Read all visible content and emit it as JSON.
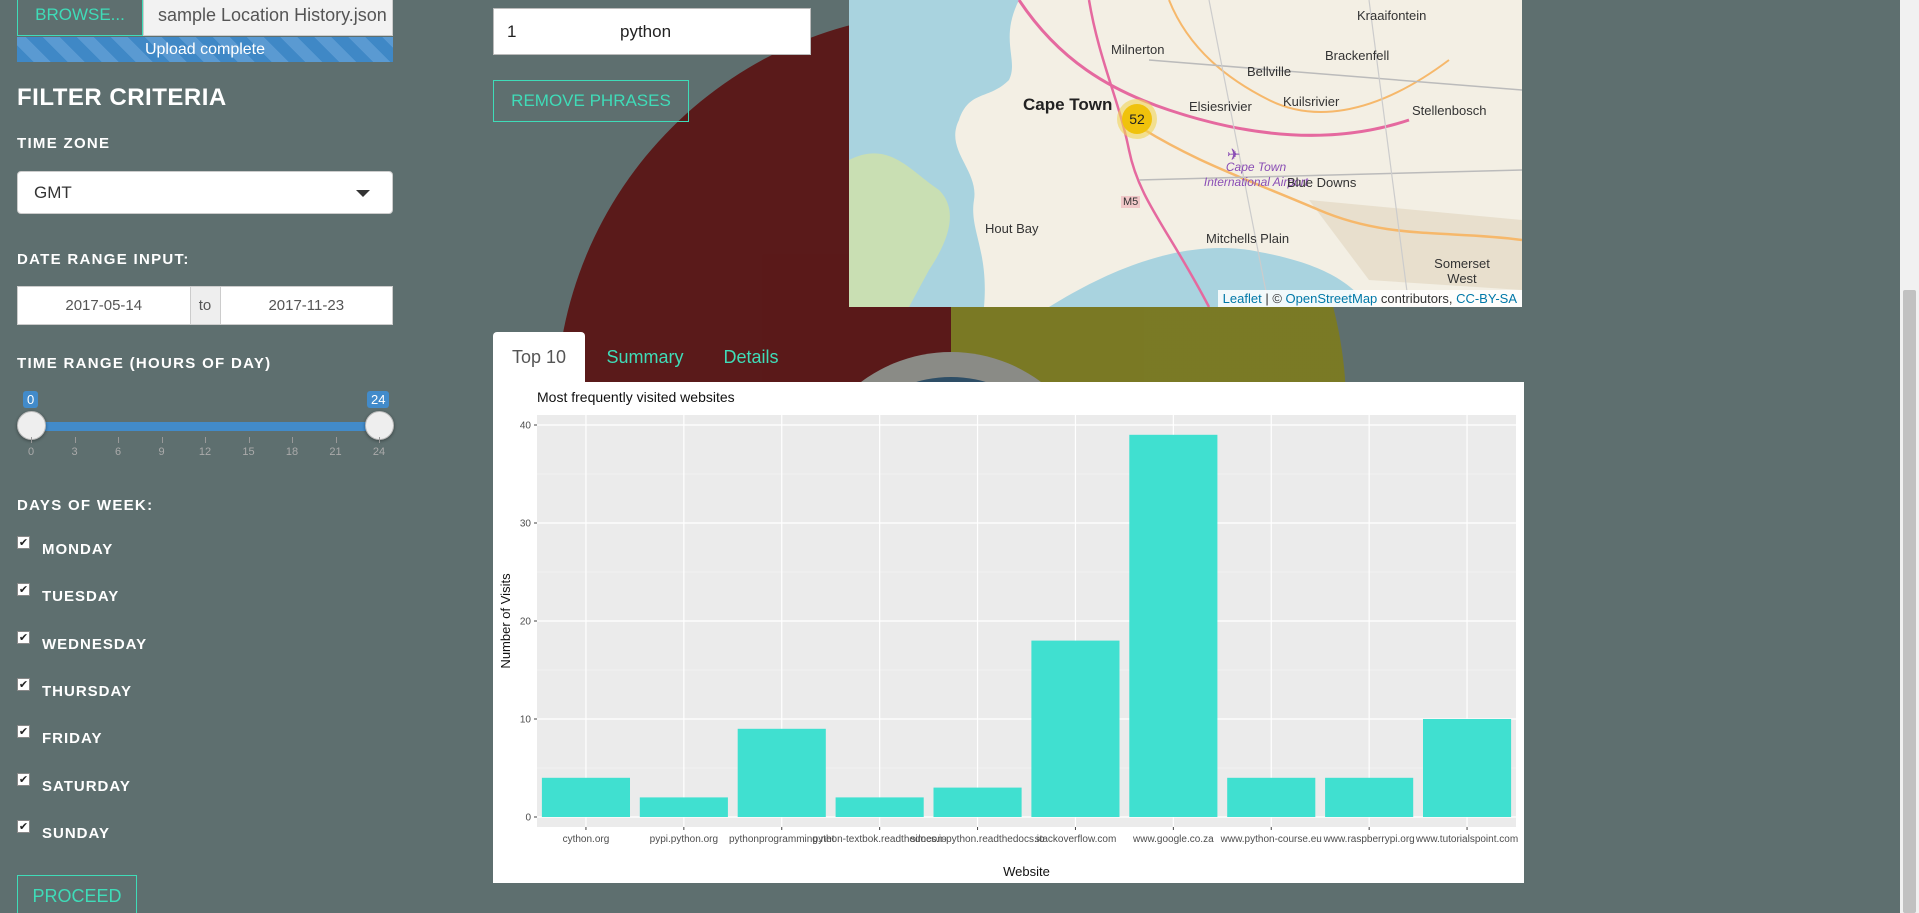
{
  "sidebar": {
    "browse_label": "BROWSE...",
    "file_name": "sample Location History.json",
    "upload_status": "Upload complete",
    "heading": "FILTER CRITERIA",
    "time_zone": {
      "label": "TIME ZONE",
      "value": "GMT"
    },
    "date_range": {
      "label": "DATE RANGE INPUT:",
      "start": "2017-05-14",
      "separator": "to",
      "end": "2017-11-23"
    },
    "time_range": {
      "label": "TIME RANGE (HOURS OF DAY)",
      "min": 0,
      "max": 24,
      "low_value": "0",
      "high_value": "24",
      "ticks": [
        "0",
        "3",
        "6",
        "9",
        "12",
        "15",
        "18",
        "21",
        "24"
      ]
    },
    "days": {
      "label": "DAYS OF WEEK:",
      "items": [
        {
          "name": "MONDAY",
          "checked": true
        },
        {
          "name": "TUESDAY",
          "checked": true
        },
        {
          "name": "WEDNESDAY",
          "checked": true
        },
        {
          "name": "THURSDAY",
          "checked": true
        },
        {
          "name": "FRIDAY",
          "checked": true
        },
        {
          "name": "SATURDAY",
          "checked": true
        },
        {
          "name": "SUNDAY",
          "checked": true
        }
      ]
    },
    "proceed_label": "PROCEED"
  },
  "phrases": {
    "row_number": "1",
    "row_text": "python",
    "remove_label": "REMOVE PHRASES"
  },
  "map": {
    "cluster_count": "52",
    "places": [
      "Kraaifontein",
      "Milnerton",
      "Brackenfell",
      "Bellville",
      "Cape Town",
      "Elsiesrivier",
      "Kuilsrivier",
      "Stellenbosch",
      "Cape Town International Airport",
      "Blue Downs",
      "M5",
      "Hout Bay",
      "Mitchells Plain",
      "Somerset West"
    ],
    "attribution": {
      "leaflet": "Leaflet",
      "sep": " | © ",
      "osm": "OpenStreetMap",
      "contrib": " contributors, ",
      "license": "CC-BY-SA"
    }
  },
  "tabs": [
    {
      "label": "Top 10",
      "active": true
    },
    {
      "label": "Summary",
      "active": false
    },
    {
      "label": "Details",
      "active": false
    }
  ],
  "colors": {
    "accent": "#3fdcb8",
    "bar": "#40e0d0",
    "slider": "#428bca",
    "plot_bg": "#ebebeb"
  },
  "chart_data": {
    "type": "bar",
    "title": "Most frequently visited websites",
    "xlabel": "Website",
    "ylabel": "Number of Visits",
    "categories": [
      "cython.org",
      "pypi.python.org",
      "pythonprogramming.net",
      "python-textbok.readthedocs.io",
      "simeon-python.readthedocs.io",
      "stackoverflow.com",
      "www.google.co.za",
      "www.python-course.eu",
      "www.raspberrypi.org",
      "www.tutorialspoint.com"
    ],
    "values": [
      4,
      2,
      9,
      2,
      3,
      18,
      39,
      4,
      4,
      10
    ],
    "ylim": [
      0,
      40
    ],
    "yticks": [
      0,
      10,
      20,
      30,
      40
    ],
    "grid": true,
    "legend": "none"
  }
}
